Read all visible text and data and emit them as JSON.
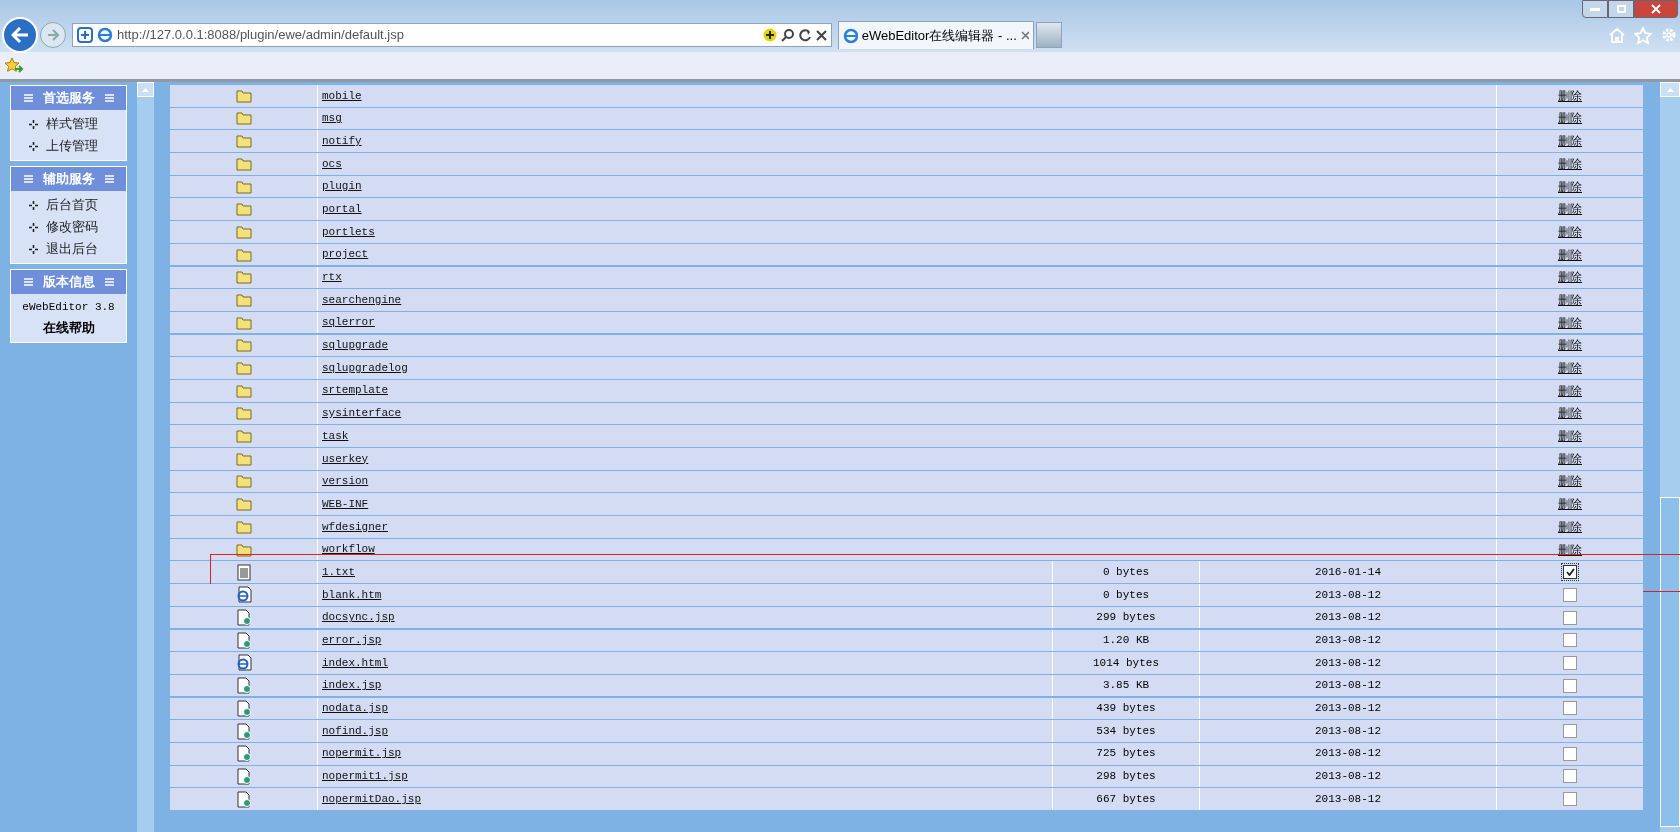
{
  "browser": {
    "address": "http://127.0.0.1:8088/plugin/ewe/admin/default.jsp",
    "tab_title": "eWebEditor在线编辑器 - ..."
  },
  "sidebar": [
    {
      "title": "首选服务",
      "items": [
        "样式管理",
        "上传管理"
      ]
    },
    {
      "title": "辅助服务",
      "items": [
        "后台首页",
        "修改密码",
        "退出后台"
      ]
    },
    {
      "title": "版本信息",
      "version": "eWebEditor 3.8",
      "help": "在线帮助"
    }
  ],
  "files": [
    {
      "kind": "folder",
      "name": "mobile",
      "action": "删除"
    },
    {
      "kind": "folder",
      "name": "msg",
      "action": "删除"
    },
    {
      "kind": "folder",
      "name": "notify",
      "action": "删除"
    },
    {
      "kind": "folder",
      "name": "ocs",
      "action": "删除"
    },
    {
      "kind": "folder",
      "name": "plugin",
      "action": "删除"
    },
    {
      "kind": "folder",
      "name": "portal",
      "action": "删除"
    },
    {
      "kind": "folder",
      "name": "portlets",
      "action": "删除"
    },
    {
      "kind": "folder",
      "name": "project",
      "action": "删除"
    },
    {
      "kind": "folder",
      "name": "rtx",
      "action": "删除"
    },
    {
      "kind": "folder",
      "name": "searchengine",
      "action": "删除"
    },
    {
      "kind": "folder",
      "name": "sqlerror",
      "action": "删除"
    },
    {
      "kind": "folder",
      "name": "sqlupgrade",
      "action": "删除"
    },
    {
      "kind": "folder",
      "name": "sqlupgradelog",
      "action": "删除"
    },
    {
      "kind": "folder",
      "name": "srtemplate",
      "action": "删除"
    },
    {
      "kind": "folder",
      "name": "sysinterface",
      "action": "删除"
    },
    {
      "kind": "folder",
      "name": "task",
      "action": "删除"
    },
    {
      "kind": "folder",
      "name": "userkey",
      "action": "删除"
    },
    {
      "kind": "folder",
      "name": "version",
      "action": "删除"
    },
    {
      "kind": "folder",
      "name": "WEB-INF",
      "action": "删除"
    },
    {
      "kind": "folder",
      "name": "wfdesigner",
      "action": "删除"
    },
    {
      "kind": "folder",
      "name": "workflow",
      "action": "删除"
    },
    {
      "kind": "text",
      "name": "1.txt",
      "size": "0 bytes",
      "date": "2016-01-14",
      "checked": true,
      "highlighted": true
    },
    {
      "kind": "web",
      "name": "blank.htm",
      "size": "0 bytes",
      "date": "2013-08-12",
      "checked": false,
      "highlighted": false
    },
    {
      "kind": "script",
      "name": "docsync.jsp",
      "size": "299 bytes",
      "date": "2013-08-12",
      "checked": false,
      "highlighted": false
    },
    {
      "kind": "script",
      "name": "error.jsp",
      "size": "1.20 KB",
      "date": "2013-08-12",
      "checked": false,
      "highlighted": false
    },
    {
      "kind": "web",
      "name": "index.html",
      "size": "1014 bytes",
      "date": "2013-08-12",
      "checked": false,
      "highlighted": false
    },
    {
      "kind": "script",
      "name": "index.jsp",
      "size": "3.85 KB",
      "date": "2013-08-12",
      "checked": false,
      "highlighted": false
    },
    {
      "kind": "script",
      "name": "nodata.jsp",
      "size": "439 bytes",
      "date": "2013-08-12",
      "checked": false,
      "highlighted": false
    },
    {
      "kind": "script",
      "name": "nofind.jsp",
      "size": "534 bytes",
      "date": "2013-08-12",
      "checked": false,
      "highlighted": false
    },
    {
      "kind": "script",
      "name": "nopermit.jsp",
      "size": "725 bytes",
      "date": "2013-08-12",
      "checked": false,
      "highlighted": false
    },
    {
      "kind": "script",
      "name": "nopermit1.jsp",
      "size": "298 bytes",
      "date": "2013-08-12",
      "checked": false,
      "highlighted": false
    },
    {
      "kind": "script",
      "name": "nopermitDao.jsp",
      "size": "667 bytes",
      "date": "2013-08-12",
      "checked": false,
      "highlighted": false
    }
  ]
}
